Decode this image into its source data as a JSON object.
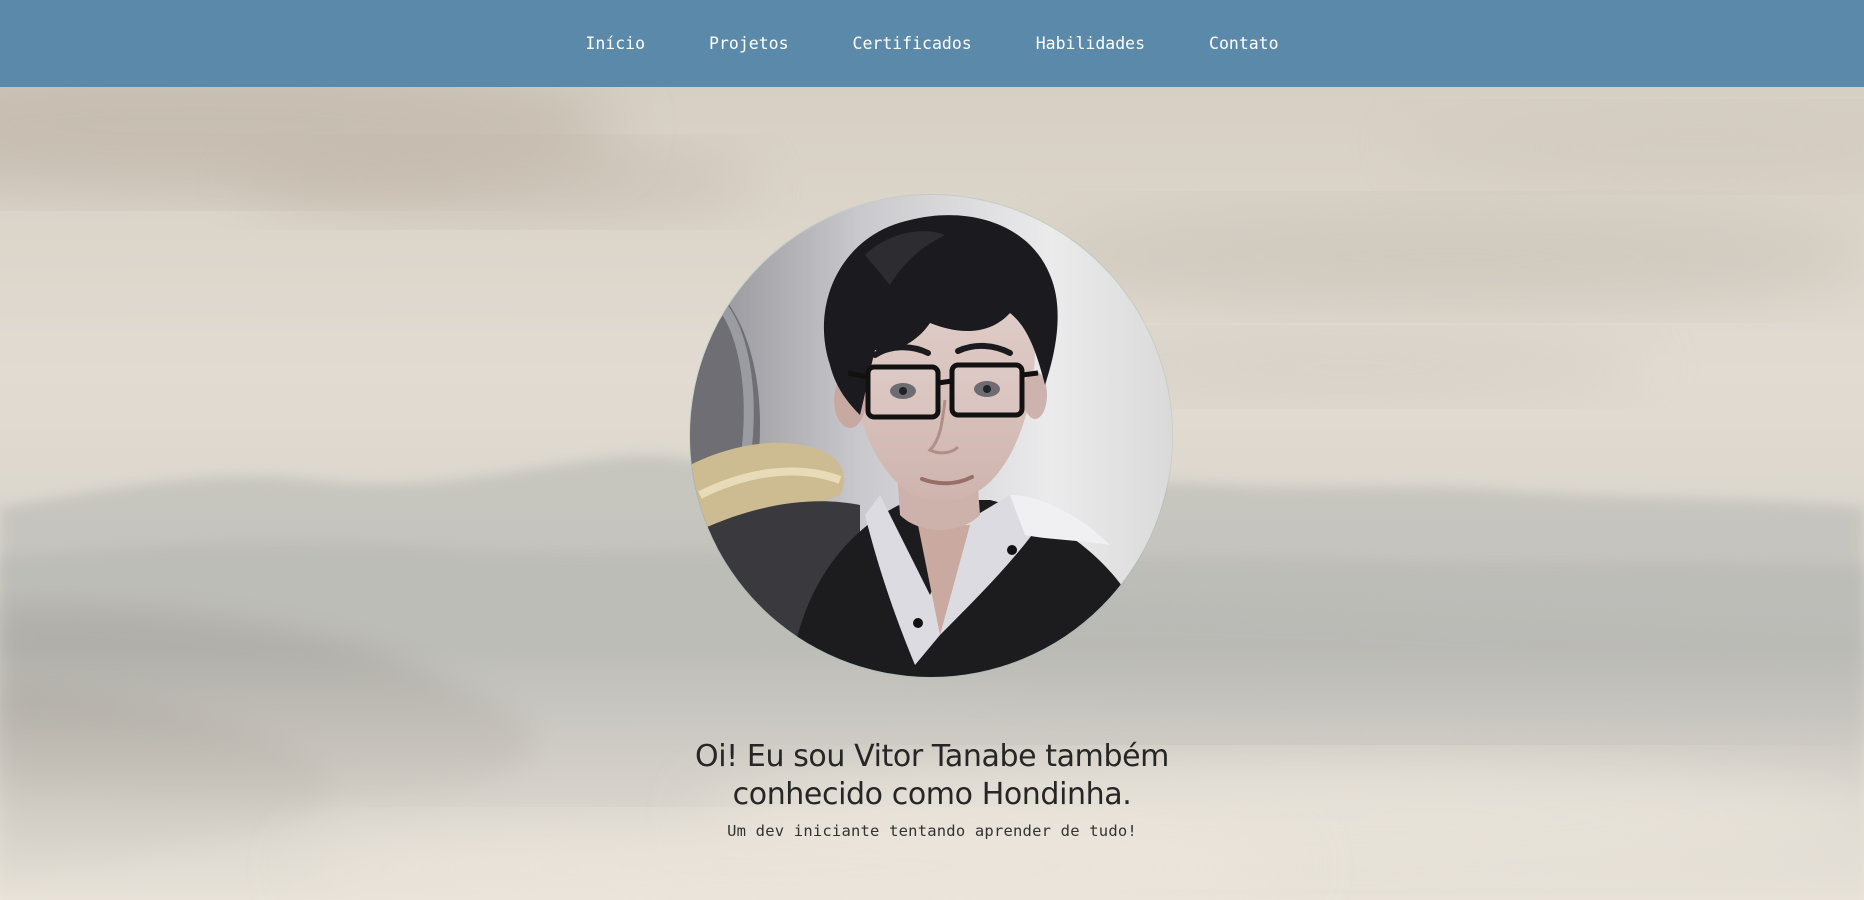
{
  "nav": {
    "items": [
      {
        "label": "Início"
      },
      {
        "label": "Projetos"
      },
      {
        "label": "Certificados"
      },
      {
        "label": "Habilidades"
      },
      {
        "label": "Contato"
      }
    ]
  },
  "hero": {
    "title": "Oi! Eu sou Vitor Tanabe também conhecido como Hondinha.",
    "subtitle": "Um dev iniciante tentando aprender de tudo!",
    "avatar_icon": "profile-photo-icon",
    "background_icon": "misty-mountains-background"
  },
  "colors": {
    "navbar": "#5b89aa",
    "nav_text": "#ffffff",
    "sky": "#e6e0d6",
    "title_text": "#262626"
  }
}
